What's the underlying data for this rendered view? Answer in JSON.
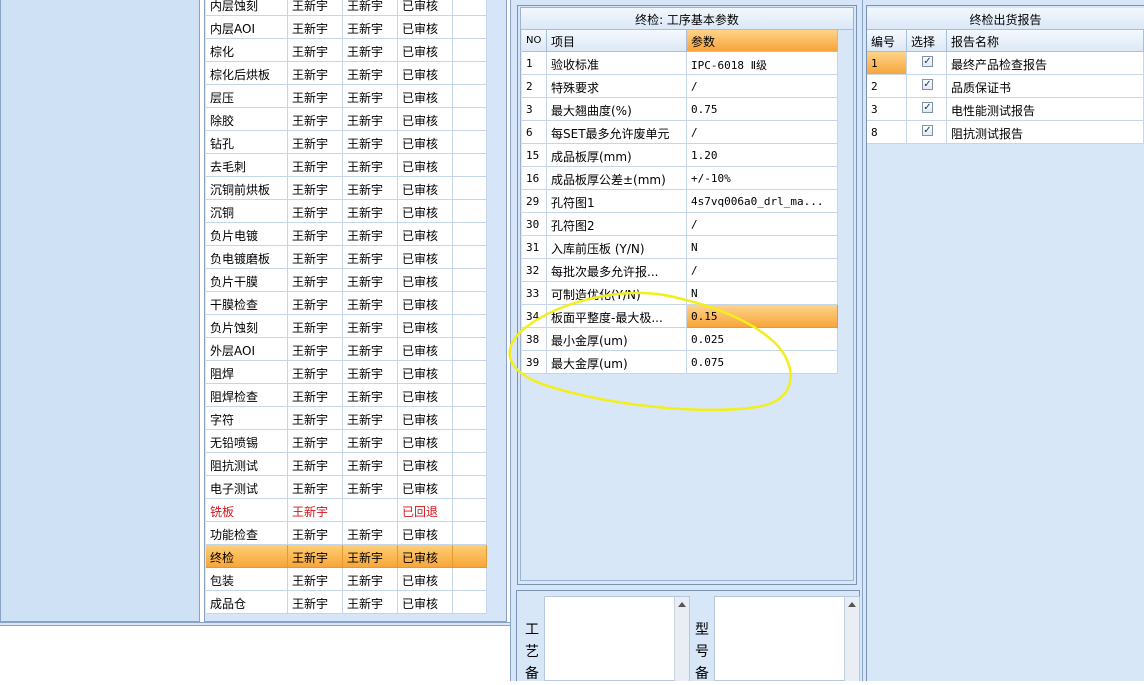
{
  "process_rows": [
    {
      "name": "内层蚀刻",
      "p1": "王新宇",
      "p2": "王新宇",
      "status": "已审核"
    },
    {
      "name": "内层AOI",
      "p1": "王新宇",
      "p2": "王新宇",
      "status": "已审核"
    },
    {
      "name": "棕化",
      "p1": "王新宇",
      "p2": "王新宇",
      "status": "已审核"
    },
    {
      "name": "棕化后烘板",
      "p1": "王新宇",
      "p2": "王新宇",
      "status": "已审核"
    },
    {
      "name": "层压",
      "p1": "王新宇",
      "p2": "王新宇",
      "status": "已审核"
    },
    {
      "name": "除胶",
      "p1": "王新宇",
      "p2": "王新宇",
      "status": "已审核"
    },
    {
      "name": "钻孔",
      "p1": "王新宇",
      "p2": "王新宇",
      "status": "已审核"
    },
    {
      "name": "去毛刺",
      "p1": "王新宇",
      "p2": "王新宇",
      "status": "已审核"
    },
    {
      "name": "沉铜前烘板",
      "p1": "王新宇",
      "p2": "王新宇",
      "status": "已审核"
    },
    {
      "name": "沉铜",
      "p1": "王新宇",
      "p2": "王新宇",
      "status": "已审核"
    },
    {
      "name": "负片电镀",
      "p1": "王新宇",
      "p2": "王新宇",
      "status": "已审核"
    },
    {
      "name": "负电镀磨板",
      "p1": "王新宇",
      "p2": "王新宇",
      "status": "已审核"
    },
    {
      "name": "负片干膜",
      "p1": "王新宇",
      "p2": "王新宇",
      "status": "已审核"
    },
    {
      "name": "干膜检查",
      "p1": "王新宇",
      "p2": "王新宇",
      "status": "已审核"
    },
    {
      "name": "负片蚀刻",
      "p1": "王新宇",
      "p2": "王新宇",
      "status": "已审核"
    },
    {
      "name": "外层AOI",
      "p1": "王新宇",
      "p2": "王新宇",
      "status": "已审核"
    },
    {
      "name": "阻焊",
      "p1": "王新宇",
      "p2": "王新宇",
      "status": "已审核"
    },
    {
      "name": "阻焊检查",
      "p1": "王新宇",
      "p2": "王新宇",
      "status": "已审核"
    },
    {
      "name": "字符",
      "p1": "王新宇",
      "p2": "王新宇",
      "status": "已审核"
    },
    {
      "name": "无铅喷锡",
      "p1": "王新宇",
      "p2": "王新宇",
      "status": "已审核"
    },
    {
      "name": "阻抗测试",
      "p1": "王新宇",
      "p2": "王新宇",
      "status": "已审核"
    },
    {
      "name": "电子测试",
      "p1": "王新宇",
      "p2": "王新宇",
      "status": "已审核"
    },
    {
      "name": "铣板",
      "p1": "王新宇",
      "p2": "",
      "status": "已回退",
      "state": "red"
    },
    {
      "name": "功能检查",
      "p1": "王新宇",
      "p2": "王新宇",
      "status": "已审核"
    },
    {
      "name": "终检",
      "p1": "王新宇",
      "p2": "王新宇",
      "status": "已审核",
      "state": "sel"
    },
    {
      "name": "包装",
      "p1": "王新宇",
      "p2": "王新宇",
      "status": "已审核"
    },
    {
      "name": "成品仓",
      "p1": "王新宇",
      "p2": "王新宇",
      "status": "已审核"
    }
  ],
  "params": {
    "title": "终检: 工序基本参数",
    "headers": {
      "no": "NO",
      "item": "项目",
      "value": "参数"
    },
    "rows": [
      {
        "no": "1",
        "item": "验收标准",
        "value": "IPC-6018 Ⅱ级"
      },
      {
        "no": "2",
        "item": "特殊要求",
        "value": "/"
      },
      {
        "no": "3",
        "item": "最大翘曲度(%)",
        "value": "0.75"
      },
      {
        "no": "6",
        "item": "每SET最多允许废单元",
        "value": "/"
      },
      {
        "no": "15",
        "item": "成品板厚(mm)",
        "value": "1.20"
      },
      {
        "no": "16",
        "item": "成品板厚公差±(mm)",
        "value": "+/-10%"
      },
      {
        "no": "29",
        "item": "孔符图1",
        "value": "4s7vq006a0_drl_ma..."
      },
      {
        "no": "30",
        "item": "孔符图2",
        "value": "/"
      },
      {
        "no": "31",
        "item": "入库前压板 (Y/N)",
        "value": "N"
      },
      {
        "no": "32",
        "item": "每批次最多允许报...",
        "value": "/"
      },
      {
        "no": "33",
        "item": "可制造优化(Y/N)",
        "value": "N"
      },
      {
        "no": "34",
        "item": "板面平整度-最大极...",
        "value": "0.15",
        "state": "sel"
      },
      {
        "no": "38",
        "item": "最小金厚(um)",
        "value": "0.025"
      },
      {
        "no": "39",
        "item": "最大金厚(um)",
        "value": "0.075"
      }
    ]
  },
  "bottom_fields": {
    "process_note_label": "工艺备",
    "model_note_label": "型号备"
  },
  "reports": {
    "title": "终检出货报告",
    "headers": {
      "no": "编号",
      "select": "选择",
      "name": "报告名称"
    },
    "rows": [
      {
        "no": "1",
        "checked": true,
        "name": "最终产品检查报告",
        "state": "sel"
      },
      {
        "no": "2",
        "checked": true,
        "name": "品质保证书"
      },
      {
        "no": "3",
        "checked": true,
        "name": "电性能测试报告"
      },
      {
        "no": "8",
        "checked": true,
        "name": "阻抗测试报告"
      }
    ]
  }
}
